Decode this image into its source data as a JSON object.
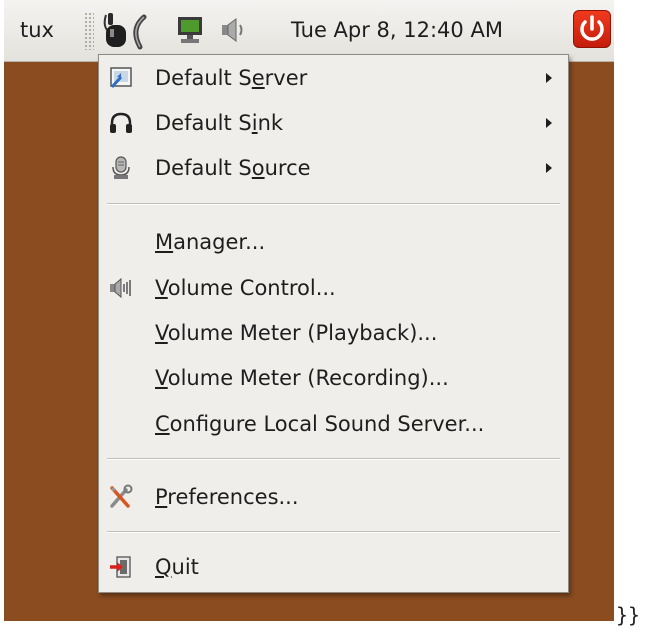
{
  "panel": {
    "user": "tux",
    "clock": "Tue Apr  8, 12:40 AM"
  },
  "menu": {
    "items": [
      {
        "pre": "Default S",
        "mn": "e",
        "post": "rver",
        "icon": "server-icon",
        "submenu": true
      },
      {
        "pre": "Default S",
        "mn": "i",
        "post": "nk",
        "icon": "headphones-icon",
        "submenu": true
      },
      {
        "pre": "Default S",
        "mn": "o",
        "post": "urce",
        "icon": "microphone-icon",
        "submenu": true
      },
      {
        "pre": "",
        "mn": "M",
        "post": "anager...",
        "icon": "",
        "submenu": false
      },
      {
        "pre": "",
        "mn": "V",
        "post": "olume Control...",
        "icon": "speaker-volume-icon",
        "submenu": false
      },
      {
        "pre": "",
        "mn": "V",
        "post": "olume Meter (Playback)...",
        "icon": "",
        "submenu": false
      },
      {
        "pre": "",
        "mn": "V",
        "post": "olume Meter (Recording)...",
        "icon": "",
        "submenu": false
      },
      {
        "pre": "",
        "mn": "C",
        "post": "onfigure Local Sound Server...",
        "icon": "",
        "submenu": false
      },
      {
        "pre": "",
        "mn": "P",
        "post": "references...",
        "icon": "tools-icon",
        "submenu": false
      },
      {
        "pre": "",
        "mn": "Q",
        "post": "uit",
        "icon": "exit-icon",
        "submenu": false
      }
    ]
  },
  "stray_text": "}}",
  "colors": {
    "desktop": "#8b4c1f",
    "power_button": "#e0301a",
    "menu_background": "#efeeeb"
  }
}
